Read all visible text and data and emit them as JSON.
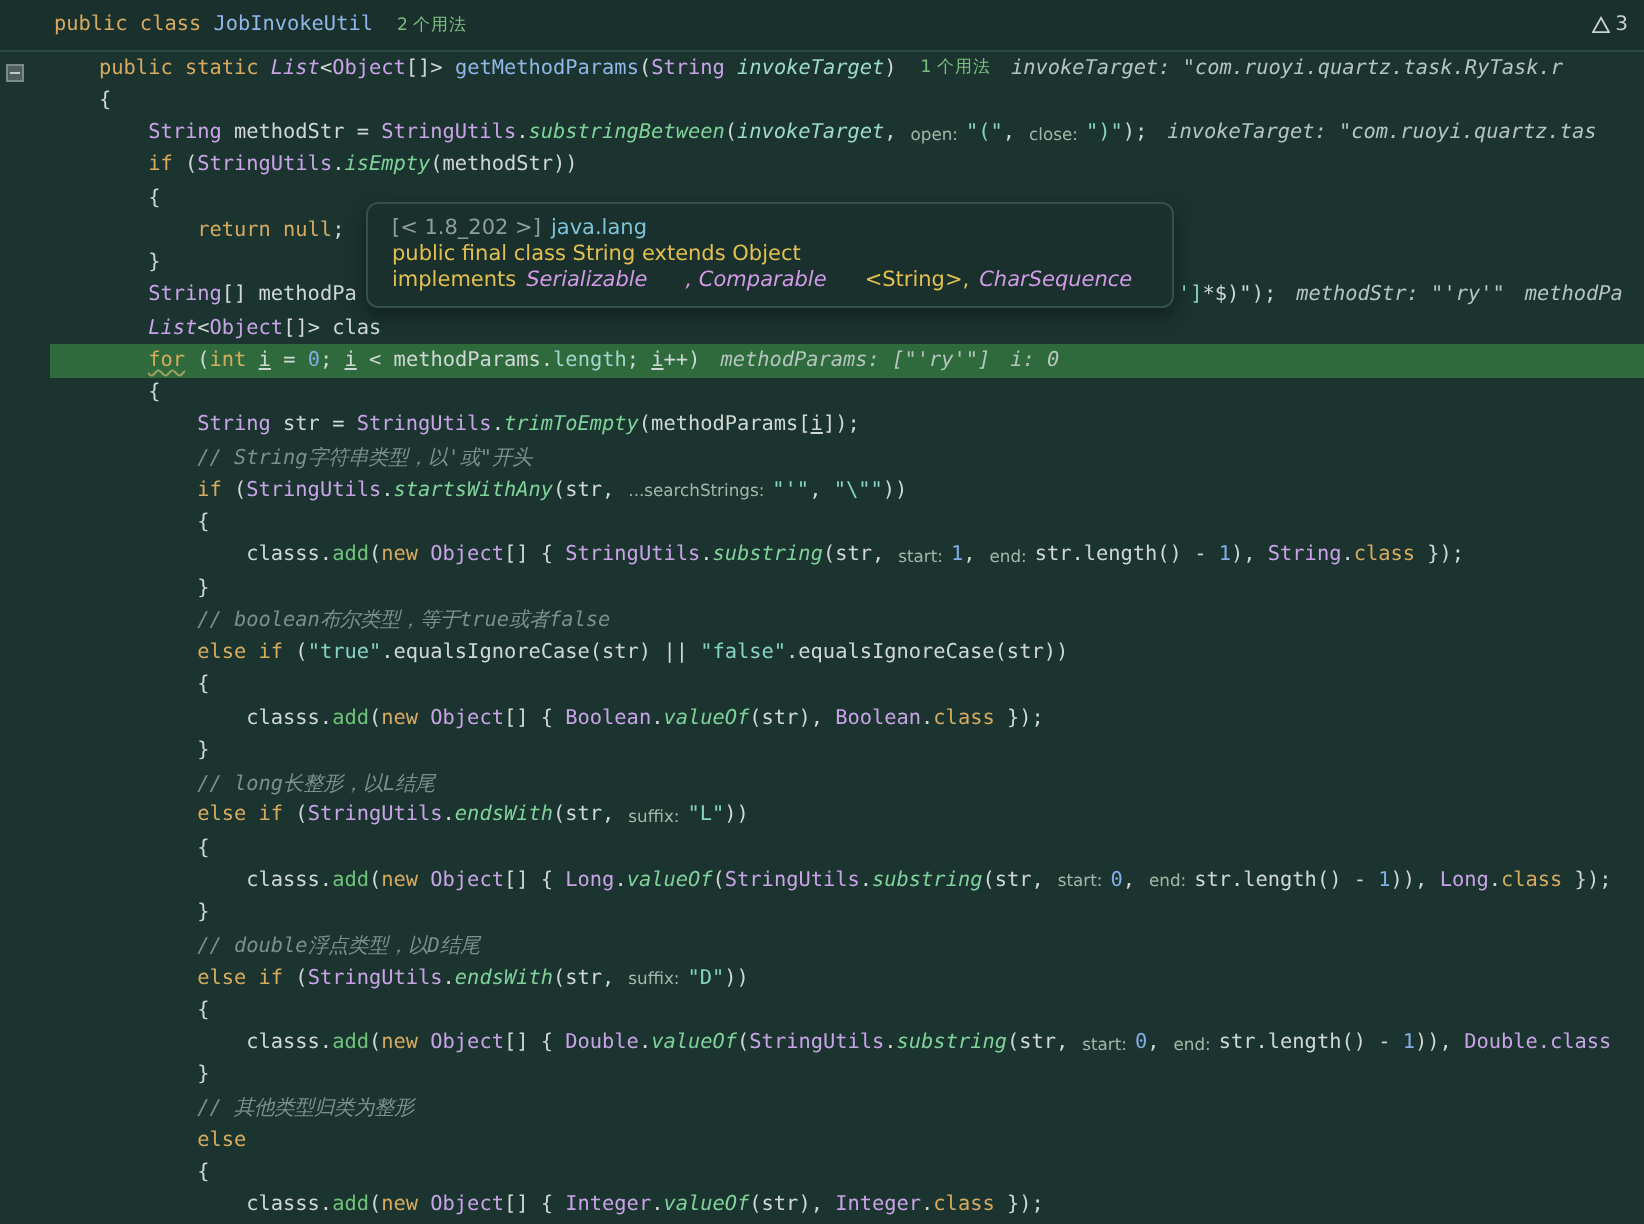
{
  "header": {
    "tokens": [
      {
        "kind": "kw",
        "text": "public class "
      },
      {
        "kind": "cls",
        "text": "JobInvokeUtil"
      },
      {
        "kind": "usage",
        "text": "2 个用法"
      }
    ],
    "warnings": "3"
  },
  "lines": [
    {
      "highlighted": false,
      "tokens": [
        {
          "kind": "kw",
          "text": "public static "
        },
        {
          "kind": "itype",
          "text": "List"
        },
        {
          "kind": "plain",
          "text": "<"
        },
        {
          "kind": "type",
          "text": "Object"
        },
        {
          "kind": "plain",
          "text": "[]> "
        },
        {
          "kind": "decl",
          "text": "getMethodParams"
        },
        {
          "kind": "plain",
          "text": "("
        },
        {
          "kind": "type",
          "text": "String "
        },
        {
          "kind": "param",
          "text": "invokeTarget"
        },
        {
          "kind": "plain",
          "text": ")"
        },
        {
          "kind": "usage",
          "text": "1 个用法"
        },
        {
          "kind": "dbg",
          "text": "invokeTarget: \"com.ruoyi.quartz.task.RyTask.r"
        }
      ]
    },
    {
      "highlighted": false,
      "tokens": [
        {
          "kind": "plain",
          "text": "{"
        }
      ],
      "children": [
        {
          "highlighted": false,
          "tokens": [
            {
              "kind": "type",
              "text": "String"
            },
            {
              "kind": "plain",
              "text": " methodStr = "
            },
            {
              "kind": "type",
              "text": "StringUtils"
            },
            {
              "kind": "plain",
              "text": "."
            },
            {
              "kind": "fn",
              "text": "substringBetween"
            },
            {
              "kind": "plain",
              "text": "("
            },
            {
              "kind": "param",
              "text": "invokeTarget"
            },
            {
              "kind": "plain",
              "text": ","
            },
            {
              "kind": "hint",
              "text": "open:"
            },
            {
              "kind": "str",
              "text": "\"(\""
            },
            {
              "kind": "plain",
              "text": ","
            },
            {
              "kind": "hint",
              "text": "close:"
            },
            {
              "kind": "str",
              "text": "\")\""
            },
            {
              "kind": "plain",
              "text": ");"
            },
            {
              "kind": "dbg",
              "text": "invokeTarget: \"com.ruoyi.quartz.tas"
            }
          ]
        },
        {
          "highlighted": false,
          "tokens": [
            {
              "kind": "kw",
              "text": "if "
            },
            {
              "kind": "plain",
              "text": "("
            },
            {
              "kind": "type",
              "text": "StringUtils"
            },
            {
              "kind": "plain",
              "text": "."
            },
            {
              "kind": "fn",
              "text": "isEmpty"
            },
            {
              "kind": "plain",
              "text": "(methodStr))"
            }
          ]
        },
        {
          "highlighted": false,
          "tokens": [
            {
              "kind": "plain",
              "text": "{"
            }
          ],
          "children": [
            {
              "highlighted": false,
              "tokens": [
                {
                  "kind": "kw",
                  "text": "return null"
                },
                {
                  "kind": "plain",
                  "text": ";"
                }
              ]
            }
          ]
        },
        {
          "highlighted": false,
          "tokens": [
            {
              "kind": "plain",
              "text": "}"
            }
          ]
        },
        {
          "highlighted": false,
          "tokens": [
            {
              "kind": "type",
              "text": "String"
            },
            {
              "kind": "plain",
              "text": "[] methodPa"
            }
          ],
          "after": [
            {
              "kind": "str",
              "text": "']"
            },
            {
              "kind": "plain",
              "text": "*$)\");"
            },
            {
              "kind": "dbg",
              "text": "methodStr: \"'ry'\""
            },
            {
              "kind": "dbg",
              "text": "methodPa"
            }
          ]
        },
        {
          "highlighted": false,
          "tokens": [
            {
              "kind": "itype",
              "text": "List"
            },
            {
              "kind": "plain",
              "text": "<"
            },
            {
              "kind": "type",
              "text": "Object"
            },
            {
              "kind": "plain",
              "text": "[]> clas"
            }
          ]
        },
        {
          "highlighted": true,
          "tokens": [
            {
              "kind": "kwwarn",
              "text": "for"
            },
            {
              "kind": "plain",
              "text": " ("
            },
            {
              "kind": "kw",
              "text": "int "
            },
            {
              "kind": "var",
              "text": "i"
            },
            {
              "kind": "plain",
              "text": " = "
            },
            {
              "kind": "num",
              "text": "0"
            },
            {
              "kind": "plain",
              "text": "; "
            },
            {
              "kind": "var",
              "text": "i"
            },
            {
              "kind": "plain",
              "text": " < methodParams."
            },
            {
              "kind": "field",
              "text": "length"
            },
            {
              "kind": "plain",
              "text": "; "
            },
            {
              "kind": "var",
              "text": "i"
            },
            {
              "kind": "plain",
              "text": "++)"
            },
            {
              "kind": "dbg",
              "text": "methodParams: [\"'ry'\"]"
            },
            {
              "kind": "dbg",
              "text": "i: 0"
            }
          ]
        },
        {
          "highlighted": false,
          "tokens": [
            {
              "kind": "plain",
              "text": "{"
            }
          ],
          "children": [
            {
              "highlighted": false,
              "tokens": [
                {
                  "kind": "type",
                  "text": "String"
                },
                {
                  "kind": "plain",
                  "text": " str = "
                },
                {
                  "kind": "type",
                  "text": "StringUtils"
                },
                {
                  "kind": "plain",
                  "text": "."
                },
                {
                  "kind": "fn",
                  "text": "trimToEmpty"
                },
                {
                  "kind": "plain",
                  "text": "(methodParams["
                },
                {
                  "kind": "var",
                  "text": "i"
                },
                {
                  "kind": "plain",
                  "text": "]);"
                }
              ]
            },
            {
              "highlighted": false,
              "tokens": [
                {
                  "kind": "com",
                  "text": "// String字符串类型，以'或\"开头"
                }
              ]
            },
            {
              "highlighted": false,
              "tokens": [
                {
                  "kind": "kw",
                  "text": "if "
                },
                {
                  "kind": "plain",
                  "text": "("
                },
                {
                  "kind": "type",
                  "text": "StringUtils"
                },
                {
                  "kind": "plain",
                  "text": "."
                },
                {
                  "kind": "fn",
                  "text": "startsWithAny"
                },
                {
                  "kind": "plain",
                  "text": "(str,"
                },
                {
                  "kind": "hint",
                  "text": "...searchStrings:"
                },
                {
                  "kind": "str",
                  "text": "\"'\""
                },
                {
                  "kind": "plain",
                  "text": ", "
                },
                {
                  "kind": "str",
                  "text": "\"\\\"\""
                },
                {
                  "kind": "plain",
                  "text": "))"
                }
              ]
            },
            {
              "highlighted": false,
              "tokens": [
                {
                  "kind": "plain",
                  "text": "{"
                }
              ],
              "children": [
                {
                  "highlighted": false,
                  "tokens": [
                    {
                      "kind": "plain",
                      "text": "classs."
                    },
                    {
                      "kind": "call",
                      "text": "add"
                    },
                    {
                      "kind": "plain",
                      "text": "("
                    },
                    {
                      "kind": "kw",
                      "text": "new "
                    },
                    {
                      "kind": "type",
                      "text": "Object"
                    },
                    {
                      "kind": "plain",
                      "text": "[] { "
                    },
                    {
                      "kind": "type",
                      "text": "StringUtils"
                    },
                    {
                      "kind": "plain",
                      "text": "."
                    },
                    {
                      "kind": "fn",
                      "text": "substring"
                    },
                    {
                      "kind": "plain",
                      "text": "(str,"
                    },
                    {
                      "kind": "hint",
                      "text": "start:"
                    },
                    {
                      "kind": "num",
                      "text": "1"
                    },
                    {
                      "kind": "plain",
                      "text": ","
                    },
                    {
                      "kind": "hint",
                      "text": "end:"
                    },
                    {
                      "kind": "plain",
                      "text": "str.length() - "
                    },
                    {
                      "kind": "num",
                      "text": "1"
                    },
                    {
                      "kind": "plain",
                      "text": "), "
                    },
                    {
                      "kind": "type",
                      "text": "String"
                    },
                    {
                      "kind": "plain",
                      "text": "."
                    },
                    {
                      "kind": "kw",
                      "text": "class"
                    },
                    {
                      "kind": "plain",
                      "text": " });"
                    }
                  ]
                }
              ]
            },
            {
              "highlighted": false,
              "tokens": [
                {
                  "kind": "plain",
                  "text": "}"
                }
              ]
            },
            {
              "highlighted": false,
              "tokens": [
                {
                  "kind": "com",
                  "text": "// boolean布尔类型，等于true或者false"
                }
              ]
            },
            {
              "highlighted": false,
              "tokens": [
                {
                  "kind": "kw",
                  "text": "else if "
                },
                {
                  "kind": "plain",
                  "text": "("
                },
                {
                  "kind": "str",
                  "text": "\"true\""
                },
                {
                  "kind": "plain",
                  "text": ".equalsIgnoreCase(str) || "
                },
                {
                  "kind": "str",
                  "text": "\"false\""
                },
                {
                  "kind": "plain",
                  "text": ".equalsIgnoreCase(str))"
                }
              ]
            },
            {
              "highlighted": false,
              "tokens": [
                {
                  "kind": "plain",
                  "text": "{"
                }
              ],
              "children": [
                {
                  "highlighted": false,
                  "tokens": [
                    {
                      "kind": "plain",
                      "text": "classs."
                    },
                    {
                      "kind": "call",
                      "text": "add"
                    },
                    {
                      "kind": "plain",
                      "text": "("
                    },
                    {
                      "kind": "kw",
                      "text": "new "
                    },
                    {
                      "kind": "type",
                      "text": "Object"
                    },
                    {
                      "kind": "plain",
                      "text": "[] { "
                    },
                    {
                      "kind": "type",
                      "text": "Boolean"
                    },
                    {
                      "kind": "plain",
                      "text": "."
                    },
                    {
                      "kind": "fn",
                      "text": "valueOf"
                    },
                    {
                      "kind": "plain",
                      "text": "(str), "
                    },
                    {
                      "kind": "type",
                      "text": "Boolean"
                    },
                    {
                      "kind": "plain",
                      "text": "."
                    },
                    {
                      "kind": "kw",
                      "text": "class"
                    },
                    {
                      "kind": "plain",
                      "text": " });"
                    }
                  ]
                }
              ]
            },
            {
              "highlighted": false,
              "tokens": [
                {
                  "kind": "plain",
                  "text": "}"
                }
              ]
            },
            {
              "highlighted": false,
              "tokens": [
                {
                  "kind": "com",
                  "text": "// long长整形，以L结尾"
                }
              ]
            },
            {
              "highlighted": false,
              "tokens": [
                {
                  "kind": "kw",
                  "text": "else if "
                },
                {
                  "kind": "plain",
                  "text": "("
                },
                {
                  "kind": "type",
                  "text": "StringUtils"
                },
                {
                  "kind": "plain",
                  "text": "."
                },
                {
                  "kind": "fn",
                  "text": "endsWith"
                },
                {
                  "kind": "plain",
                  "text": "(str,"
                },
                {
                  "kind": "hint",
                  "text": "suffix:"
                },
                {
                  "kind": "str",
                  "text": "\"L\""
                },
                {
                  "kind": "plain",
                  "text": "))"
                }
              ]
            },
            {
              "highlighted": false,
              "tokens": [
                {
                  "kind": "plain",
                  "text": "{"
                }
              ],
              "children": [
                {
                  "highlighted": false,
                  "tokens": [
                    {
                      "kind": "plain",
                      "text": "classs."
                    },
                    {
                      "kind": "call",
                      "text": "add"
                    },
                    {
                      "kind": "plain",
                      "text": "("
                    },
                    {
                      "kind": "kw",
                      "text": "new "
                    },
                    {
                      "kind": "type",
                      "text": "Object"
                    },
                    {
                      "kind": "plain",
                      "text": "[] { "
                    },
                    {
                      "kind": "type",
                      "text": "Long"
                    },
                    {
                      "kind": "plain",
                      "text": "."
                    },
                    {
                      "kind": "fn",
                      "text": "valueOf"
                    },
                    {
                      "kind": "plain",
                      "text": "("
                    },
                    {
                      "kind": "type",
                      "text": "StringUtils"
                    },
                    {
                      "kind": "plain",
                      "text": "."
                    },
                    {
                      "kind": "fn",
                      "text": "substring"
                    },
                    {
                      "kind": "plain",
                      "text": "(str,"
                    },
                    {
                      "kind": "hint",
                      "text": "start:"
                    },
                    {
                      "kind": "num",
                      "text": "0"
                    },
                    {
                      "kind": "plain",
                      "text": ","
                    },
                    {
                      "kind": "hint",
                      "text": "end:"
                    },
                    {
                      "kind": "plain",
                      "text": "str.length() - "
                    },
                    {
                      "kind": "num",
                      "text": "1"
                    },
                    {
                      "kind": "plain",
                      "text": ")), "
                    },
                    {
                      "kind": "type",
                      "text": "Long"
                    },
                    {
                      "kind": "plain",
                      "text": "."
                    },
                    {
                      "kind": "kw",
                      "text": "class"
                    },
                    {
                      "kind": "plain",
                      "text": " });"
                    }
                  ]
                }
              ]
            },
            {
              "highlighted": false,
              "tokens": [
                {
                  "kind": "plain",
                  "text": "}"
                }
              ]
            },
            {
              "highlighted": false,
              "tokens": [
                {
                  "kind": "com",
                  "text": "// double浮点类型，以D结尾"
                }
              ]
            },
            {
              "highlighted": false,
              "tokens": [
                {
                  "kind": "kw",
                  "text": "else if "
                },
                {
                  "kind": "plain",
                  "text": "("
                },
                {
                  "kind": "type",
                  "text": "StringUtils"
                },
                {
                  "kind": "plain",
                  "text": "."
                },
                {
                  "kind": "fn",
                  "text": "endsWith"
                },
                {
                  "kind": "plain",
                  "text": "(str,"
                },
                {
                  "kind": "hint",
                  "text": "suffix:"
                },
                {
                  "kind": "str",
                  "text": "\"D\""
                },
                {
                  "kind": "plain",
                  "text": "))"
                }
              ]
            },
            {
              "highlighted": false,
              "tokens": [
                {
                  "kind": "plain",
                  "text": "{"
                }
              ],
              "children": [
                {
                  "highlighted": false,
                  "tokens": [
                    {
                      "kind": "plain",
                      "text": "classs."
                    },
                    {
                      "kind": "call",
                      "text": "add"
                    },
                    {
                      "kind": "plain",
                      "text": "("
                    },
                    {
                      "kind": "kw",
                      "text": "new "
                    },
                    {
                      "kind": "type",
                      "text": "Object"
                    },
                    {
                      "kind": "plain",
                      "text": "[] { "
                    },
                    {
                      "kind": "type",
                      "text": "Double"
                    },
                    {
                      "kind": "plain",
                      "text": "."
                    },
                    {
                      "kind": "fn",
                      "text": "valueOf"
                    },
                    {
                      "kind": "plain",
                      "text": "("
                    },
                    {
                      "kind": "type",
                      "text": "StringUtils"
                    },
                    {
                      "kind": "plain",
                      "text": "."
                    },
                    {
                      "kind": "fn",
                      "text": "substring"
                    },
                    {
                      "kind": "plain",
                      "text": "(str,"
                    },
                    {
                      "kind": "hint",
                      "text": "start:"
                    },
                    {
                      "kind": "num",
                      "text": "0"
                    },
                    {
                      "kind": "plain",
                      "text": ","
                    },
                    {
                      "kind": "hint",
                      "text": "end:"
                    },
                    {
                      "kind": "plain",
                      "text": "str.length() - "
                    },
                    {
                      "kind": "num",
                      "text": "1"
                    },
                    {
                      "kind": "plain",
                      "text": ")), "
                    },
                    {
                      "kind": "type",
                      "text": "Double.class"
                    }
                  ]
                }
              ]
            },
            {
              "highlighted": false,
              "tokens": [
                {
                  "kind": "plain",
                  "text": "}"
                }
              ]
            },
            {
              "highlighted": false,
              "tokens": [
                {
                  "kind": "com",
                  "text": "// 其他类型归类为整形"
                }
              ]
            },
            {
              "highlighted": false,
              "tokens": [
                {
                  "kind": "kw",
                  "text": "else"
                }
              ]
            },
            {
              "highlighted": false,
              "tokens": [
                {
                  "kind": "plain",
                  "text": "{"
                }
              ],
              "children": [
                {
                  "highlighted": false,
                  "tokens": [
                    {
                      "kind": "plain",
                      "text": "classs."
                    },
                    {
                      "kind": "call",
                      "text": "add"
                    },
                    {
                      "kind": "plain",
                      "text": "("
                    },
                    {
                      "kind": "kw",
                      "text": "new "
                    },
                    {
                      "kind": "type",
                      "text": "Object"
                    },
                    {
                      "kind": "plain",
                      "text": "[] { "
                    },
                    {
                      "kind": "type",
                      "text": "Integer"
                    },
                    {
                      "kind": "plain",
                      "text": "."
                    },
                    {
                      "kind": "fn",
                      "text": "valueOf"
                    },
                    {
                      "kind": "plain",
                      "text": "(str), "
                    },
                    {
                      "kind": "type",
                      "text": "Integer"
                    },
                    {
                      "kind": "plain",
                      "text": "."
                    },
                    {
                      "kind": "kw",
                      "text": "class"
                    },
                    {
                      "kind": "plain",
                      "text": " });"
                    }
                  ]
                }
              ]
            }
          ]
        }
      ]
    }
  ],
  "tooltip": {
    "lines": [
      [
        {
          "kind": "muted",
          "text": "[< 1.8_202 >]"
        },
        {
          "kind": "link",
          "text": "java.lang"
        }
      ],
      [
        {
          "kind": "kw",
          "text": "public final class String extends Object"
        }
      ],
      [
        {
          "kind": "kw",
          "text": "implements"
        },
        {
          "kind": "itf",
          "text": "Serializable"
        },
        {
          "kind": "itf",
          "text": ", Comparable"
        },
        {
          "kind": "kw",
          "text": "<String>,"
        },
        {
          "kind": "itf",
          "text": "CharSequence"
        }
      ]
    ]
  }
}
